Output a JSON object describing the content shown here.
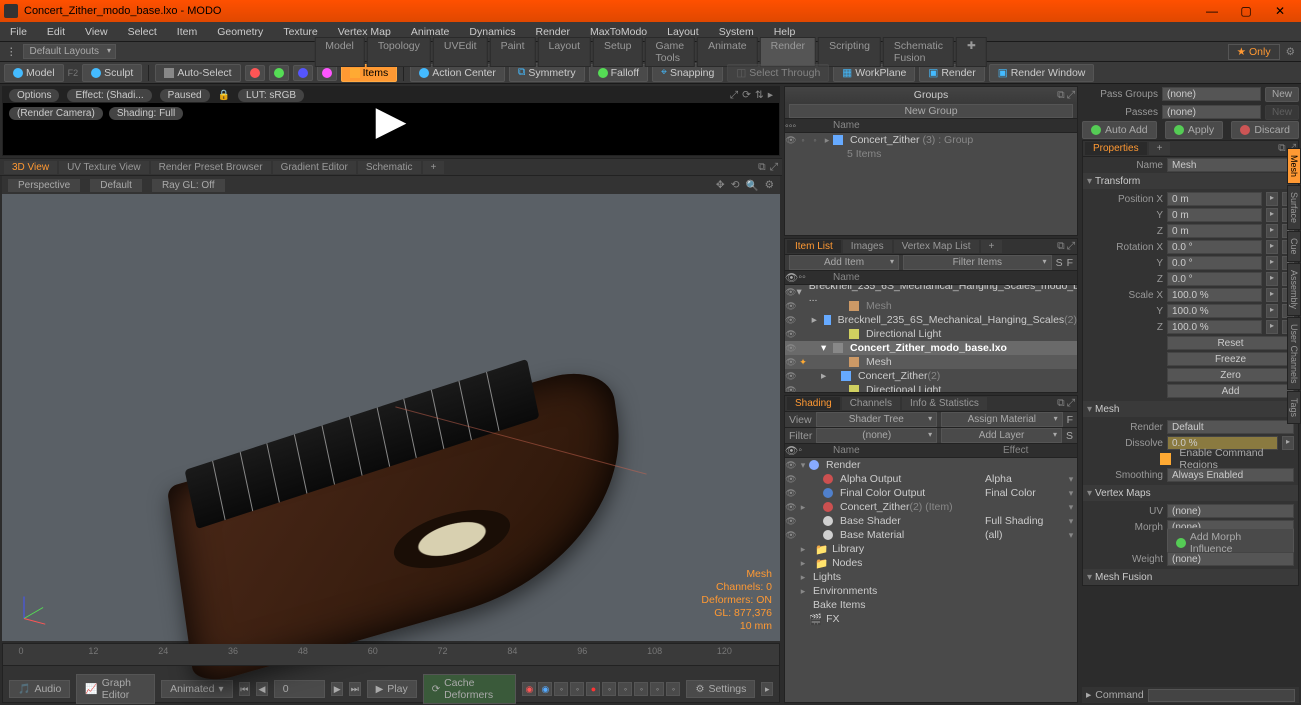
{
  "title": "Concert_Zither_modo_base.lxo - MODO",
  "menu": [
    "File",
    "Edit",
    "View",
    "Select",
    "Item",
    "Geometry",
    "Texture",
    "Vertex Map",
    "Animate",
    "Dynamics",
    "Render",
    "MaxToModo",
    "Layout",
    "System",
    "Help"
  ],
  "layouts_dd": "Default Layouts",
  "layout_tabs": [
    "Model",
    "Topology",
    "UVEdit",
    "Paint",
    "Layout",
    "Setup",
    "Game Tools",
    "Animate",
    "Render",
    "Scripting",
    "Schematic Fusion"
  ],
  "only": "Only",
  "modes": {
    "model": "Model",
    "sculpt": "Sculpt"
  },
  "tb": {
    "autoselect": "Auto-Select",
    "items": "Items",
    "actioncenter": "Action Center",
    "symmetry": "Symmetry",
    "falloff": "Falloff",
    "snapping": "Snapping",
    "selectthrough": "Select Through",
    "workplane": "WorkPlane",
    "render": "Render",
    "renderwindow": "Render Window"
  },
  "renderprev": {
    "options": "Options",
    "effect": "Effect: (Shadi...",
    "paused": "Paused",
    "lut": "LUT: sRGB",
    "camera": "(Render Camera)",
    "shading": "Shading: Full"
  },
  "viewtabs": [
    "3D View",
    "UV Texture View",
    "Render Preset Browser",
    "Gradient Editor",
    "Schematic"
  ],
  "vbar": {
    "persp": "Perspective",
    "default": "Default",
    "raygl": "Ray GL: Off"
  },
  "vinfo": {
    "mesh": "Mesh",
    "channels": "Channels: 0",
    "deformers": "Deformers: ON",
    "gl": "GL: 877,376",
    "res": "10 mm"
  },
  "timeline": {
    "ticks": [
      "0",
      "12",
      "24",
      "36",
      "48",
      "60",
      "72",
      "84",
      "96",
      "108",
      "120"
    ],
    "audio": "Audio",
    "graph": "Graph Editor",
    "animated": "Animated",
    "frame": "0",
    "play": "Play",
    "cache": "Cache Deformers",
    "settings": "Settings"
  },
  "groups": {
    "title": "Groups",
    "new": "New Group",
    "name_col": "Name",
    "item": "Concert_Zither",
    "suffix": "(3) : Group",
    "sub": "5 Items"
  },
  "itemlist": {
    "tabs": [
      "Item List",
      "Images",
      "Vertex Map List"
    ],
    "add": "Add Item",
    "filter": "Filter Items",
    "name_col": "Name",
    "rows": [
      {
        "lbl": "Brecknell_235_6S_Mechanical_Hanging_Scales_modo_bas ...",
        "type": "scene"
      },
      {
        "lbl": "Mesh",
        "type": "mesh",
        "indent": 2
      },
      {
        "lbl": "Brecknell_235_6S_Mechanical_Hanging_Scales",
        "suf": "(2)",
        "type": "group",
        "indent": 2
      },
      {
        "lbl": "Directional Light",
        "type": "light",
        "indent": 2
      },
      {
        "lbl": "Concert_Zither_modo_base.lxo",
        "type": "scene",
        "sel": true
      },
      {
        "lbl": "Mesh",
        "type": "mesh",
        "indent": 2,
        "sel2": true
      },
      {
        "lbl": "Concert_Zither",
        "suf": "(2)",
        "type": "group",
        "indent": 2
      },
      {
        "lbl": "Directional Light",
        "type": "light",
        "indent": 2
      }
    ]
  },
  "shading": {
    "tabs": [
      "Shading",
      "Channels",
      "Info & Statistics"
    ],
    "view": "View",
    "viewval": "Shader Tree",
    "assign": "Assign Material",
    "filter": "Filter",
    "filterval": "(none)",
    "addlayer": "Add Layer",
    "name_col": "Name",
    "effect_col": "Effect",
    "rows": [
      {
        "lbl": "Render",
        "eff": "",
        "c": "#88aaff"
      },
      {
        "lbl": "Alpha Output",
        "eff": "Alpha",
        "c": "#cc5050",
        "i": 1
      },
      {
        "lbl": "Final Color Output",
        "eff": "Final Color",
        "c": "#5080cc",
        "i": 1
      },
      {
        "lbl": "Concert_Zither",
        "suf": "(2) (Item)",
        "eff": "",
        "c": "#cc5050",
        "i": 1
      },
      {
        "lbl": "Base Shader",
        "eff": "Full Shading",
        "c": "#d0d0d0",
        "i": 1
      },
      {
        "lbl": "Base Material",
        "eff": "(all)",
        "c": "#d0d0d0",
        "i": 1
      },
      {
        "lbl": "Library",
        "eff": "",
        "i": 0,
        "folder": true
      },
      {
        "lbl": "Nodes",
        "eff": "",
        "i": 0,
        "folder": true
      },
      {
        "lbl": "Lights",
        "eff": "",
        "i": 0
      },
      {
        "lbl": "Environments",
        "eff": "",
        "i": 0
      },
      {
        "lbl": "Bake Items",
        "eff": "",
        "i": 0
      },
      {
        "lbl": "FX",
        "eff": "",
        "i": 0
      }
    ]
  },
  "passgroups": {
    "lbl": "Pass Groups",
    "val": "(none)",
    "new": "New",
    "passes": "Passes",
    "pval": "(none)"
  },
  "actions": {
    "autoadd": "Auto Add",
    "apply": "Apply",
    "discard": "Discard"
  },
  "props": {
    "title": "Properties",
    "name": "Name",
    "nameval": "Mesh",
    "transform": "Transform",
    "posx": "Position X",
    "y": "Y",
    "z": "Z",
    "zero": "0 m",
    "rotx": "Rotation X",
    "rzero": "0.0 °",
    "scalex": "Scale X",
    "hundred": "100.0 %",
    "reset": "Reset",
    "freeze": "Freeze",
    "zero_btn": "Zero",
    "add": "Add",
    "mesh": "Mesh",
    "render": "Render",
    "renderval": "Default",
    "dissolve": "Dissolve",
    "dval": "0.0 %",
    "enable": "Enable Command Regions",
    "smoothing": "Smoothing",
    "sval": "Always Enabled",
    "vmaps": "Vertex Maps",
    "uv": "UV",
    "none": "(none)",
    "morph": "Morph",
    "addmorph": "Add Morph Influence",
    "weight": "Weight",
    "fusion": "Mesh Fusion",
    "command": "Command"
  },
  "sidetabs": [
    "Mesh",
    "Surface",
    "Cue",
    "Assembly",
    "User Channels",
    "Tags"
  ]
}
